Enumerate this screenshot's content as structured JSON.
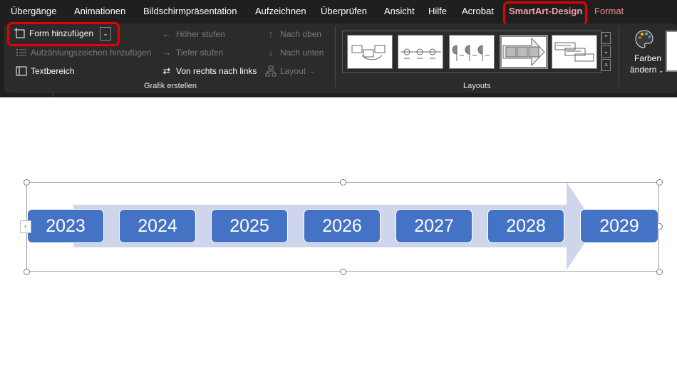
{
  "tabs": [
    {
      "label": "Übergänge"
    },
    {
      "label": "Animationen"
    },
    {
      "label": "Bildschirmpräsentation"
    },
    {
      "label": "Aufzeichnen"
    },
    {
      "label": "Überprüfen"
    },
    {
      "label": "Ansicht"
    },
    {
      "label": "Hilfe"
    },
    {
      "label": "Acrobat"
    },
    {
      "label": "SmartArt-Design"
    },
    {
      "label": "Format"
    }
  ],
  "grafik_erstellen": {
    "form_hinzufuegen": "Form hinzufügen",
    "aufzaehlungszeichen": "Aufzählungszeichen hinzufügen",
    "textbereich": "Textbereich",
    "hoeher_stufen": "Höher stufen",
    "tiefer_stufen": "Tiefer stufen",
    "von_rechts_nach_links": "Von rechts nach links",
    "nach_oben": "Nach oben",
    "nach_unten": "Nach unten",
    "layout": "Layout",
    "group_label": "Grafik erstellen"
  },
  "layouts": {
    "group_label": "Layouts"
  },
  "farben": {
    "line1": "Farben",
    "line2": "ändern"
  },
  "timeline": {
    "years": [
      "2023",
      "2024",
      "2025",
      "2026",
      "2027",
      "2028",
      "2029"
    ]
  },
  "colors": {
    "accent": "#4472c4",
    "arrow": "#cfd5ea",
    "highlight": "#e80000",
    "ribbon_bg": "#1f1f1f"
  }
}
